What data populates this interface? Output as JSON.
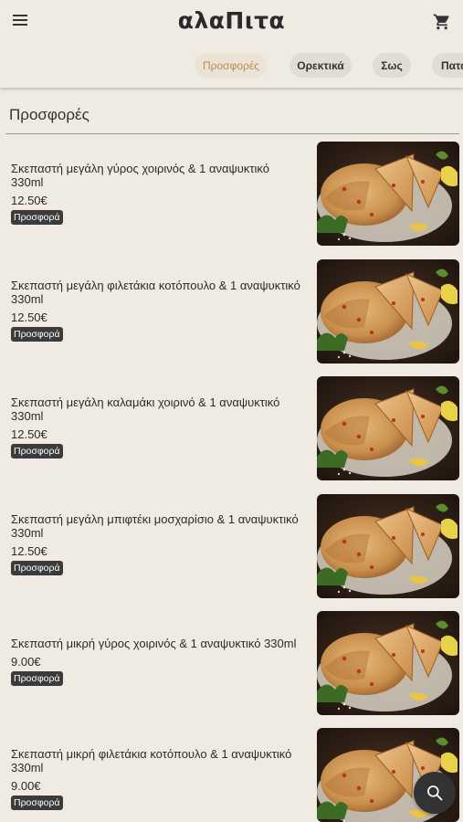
{
  "app": {
    "logo": "αλαΠιτα"
  },
  "tabs": [
    {
      "label": "Προσφορές",
      "active": true
    },
    {
      "label": "Ορεκτικά",
      "active": false
    },
    {
      "label": "Σως",
      "active": false
    },
    {
      "label": "Πατάτες",
      "active": false
    }
  ],
  "section": {
    "title": "Προσφορές"
  },
  "items": [
    {
      "name": "Σκεπαστή μεγάλη γύρος χοιρινός & 1 αναψυκτικό 330ml",
      "price": "12.50€",
      "badge": "Προσφορά"
    },
    {
      "name": "Σκεπαστή μεγάλη φιλετάκια κοτόπουλο & 1 αναψυκτικό 330ml",
      "price": "12.50€",
      "badge": "Προσφορά"
    },
    {
      "name": "Σκεπαστή μεγάλη καλαμάκι χοιρινό & 1 αναψυκτικό 330ml",
      "price": "12.50€",
      "badge": "Προσφορά"
    },
    {
      "name": "Σκεπαστή μεγάλη μπιφτέκι μοσχαρίσιο & 1 αναψυκτικό 330ml",
      "price": "12.50€",
      "badge": "Προσφορά"
    },
    {
      "name": "Σκεπαστή μικρή γύρος χοιρινός & 1 αναψυκτικό 330ml",
      "price": "9.00€",
      "badge": "Προσφορά"
    },
    {
      "name": "Σκεπαστή μικρή φιλετάκια κοτόπουλο & 1 αναψυκτικό 330ml",
      "price": "9.00€",
      "badge": "Προσφορά"
    }
  ],
  "icons": {
    "menu": "hamburger-menu-icon",
    "cart": "shopping-cart-icon",
    "search": "search-icon"
  },
  "colors": {
    "background": "#efebe3",
    "active_tab_text": "#b9894e",
    "badge": "#3b3b3b",
    "fab": "#333333"
  }
}
